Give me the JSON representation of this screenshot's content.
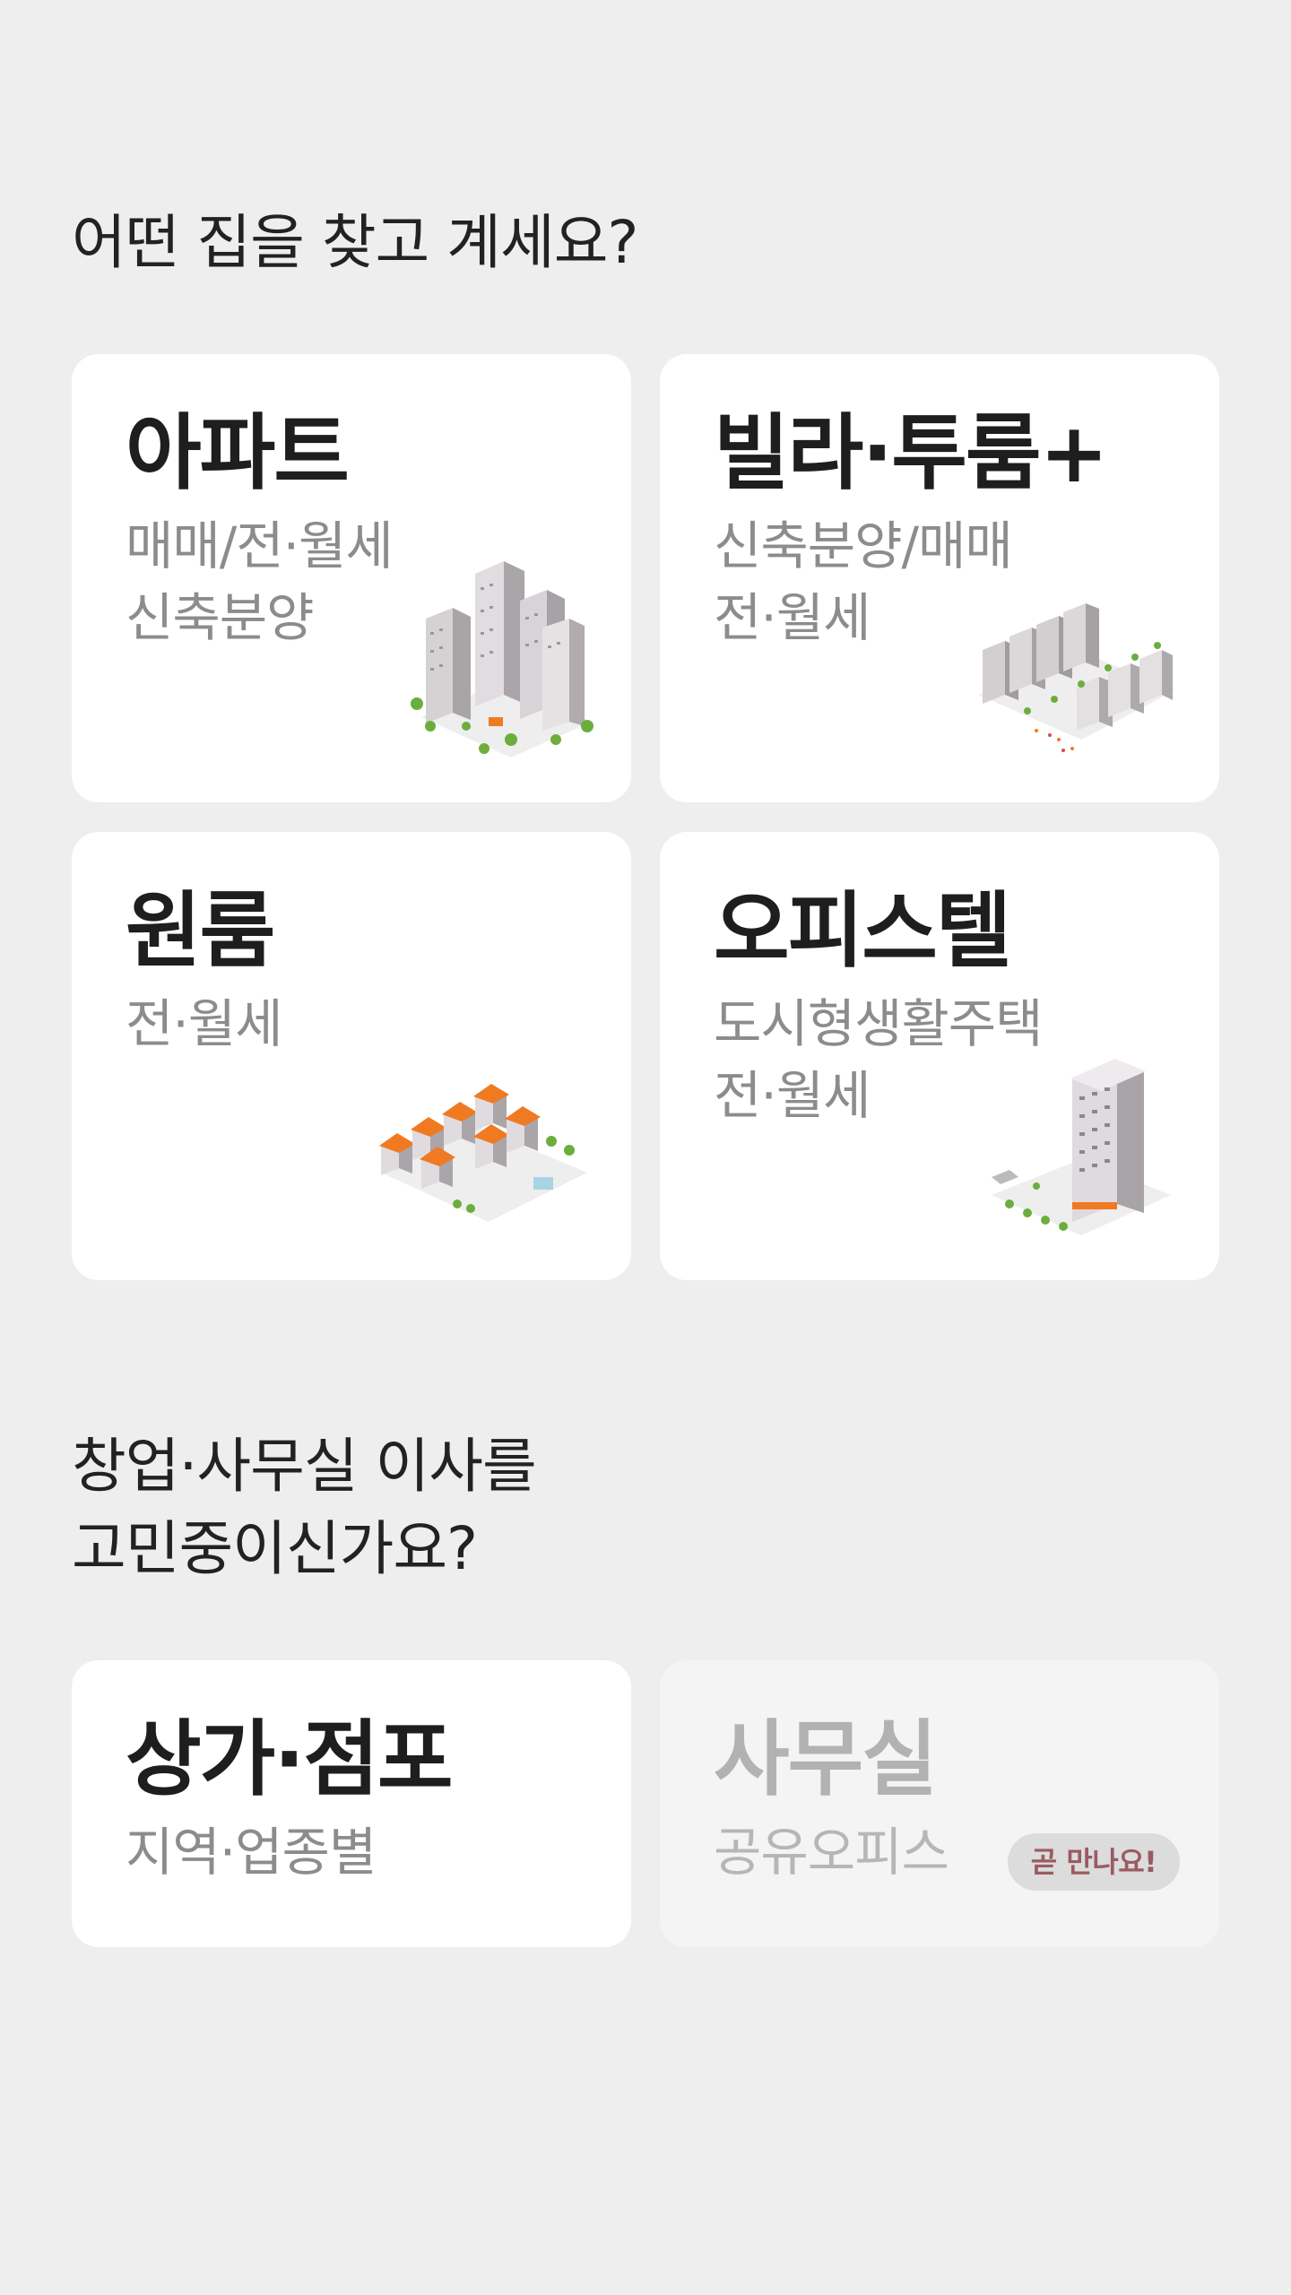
{
  "home_section": {
    "title": "어떤 집을 찾고 계세요?",
    "cards": [
      {
        "title": "아파트",
        "sub1": "매매/전·월세",
        "sub2": "신축분양",
        "icon": "apartment-complex-illustration"
      },
      {
        "title": "빌라·투룸+",
        "sub1": "신축분양/매매",
        "sub2": "전·월세",
        "icon": "villa-complex-illustration"
      },
      {
        "title": "원룸",
        "sub1": "전·월세",
        "sub2": "",
        "icon": "oneroom-houses-illustration"
      },
      {
        "title": "오피스텔",
        "sub1": "도시형생활주택",
        "sub2": "전·월세",
        "icon": "officetel-tower-illustration"
      }
    ]
  },
  "business_section": {
    "title_line1": "창업·사무실 이사를",
    "title_line2": "고민중이신가요?",
    "cards": [
      {
        "title": "상가·점포",
        "sub1": "지역·업종별"
      },
      {
        "title": "사무실",
        "sub1": "공유오피스",
        "badge": "곧 만나요!",
        "disabled": true
      }
    ]
  },
  "colors": {
    "background": "#eeeeee",
    "card": "#ffffff",
    "title_text": "#1e1e1e",
    "sub_text": "#8c8c8c",
    "roof_orange": "#f07a22",
    "badge_text": "#9a5b62"
  }
}
